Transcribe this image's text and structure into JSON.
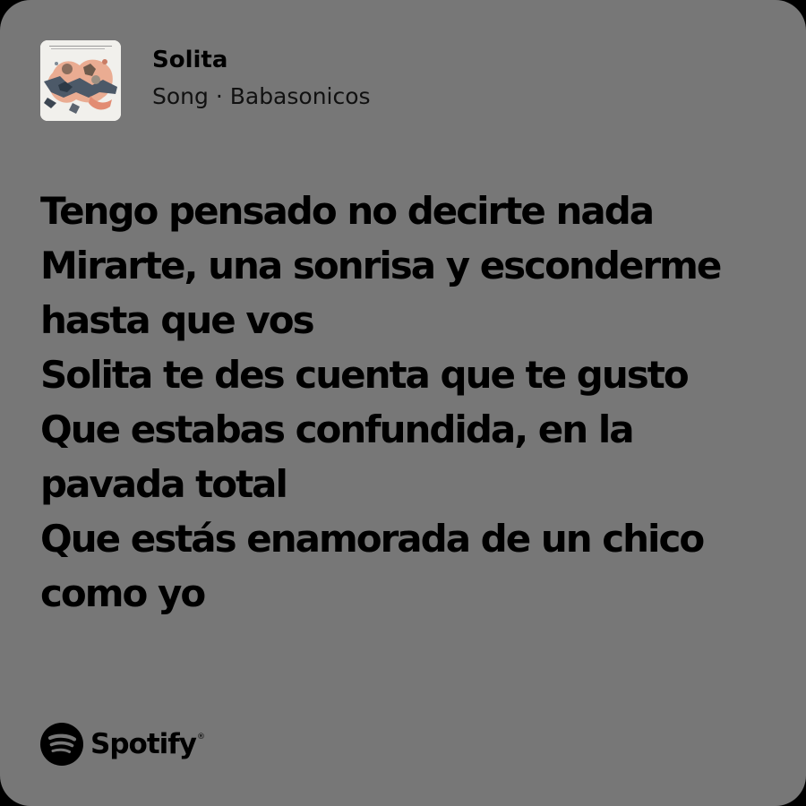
{
  "song": {
    "title": "Solita",
    "meta": "Song · Babasonicos",
    "cover_icon": "album-cover-collage"
  },
  "lyrics": {
    "lines": [
      "Tengo pensado no decirte nada",
      "Mirarte, una sonrisa y esconderme",
      "hasta que vos",
      "Solita te des cuenta que te gusto",
      "Que estabas confundida, en la",
      "pavada total",
      "Que estás enamorada de un chico",
      "como yo"
    ]
  },
  "brand": {
    "name": "Spotify",
    "trademark": "®",
    "icon": "spotify-icon"
  },
  "colors": {
    "card_background": "#777777",
    "text": "#000000"
  }
}
